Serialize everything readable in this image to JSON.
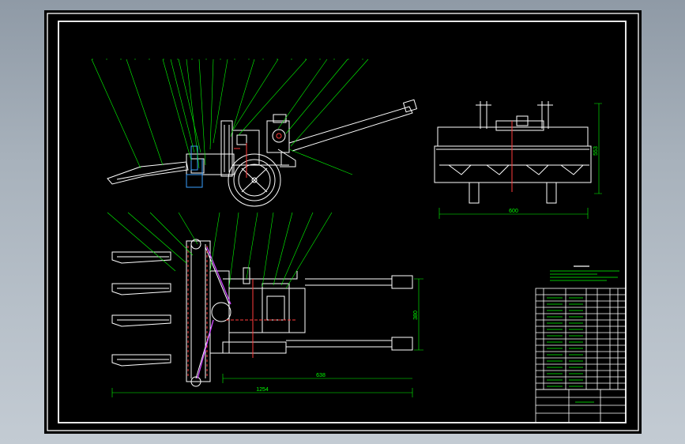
{
  "drawing": {
    "theme_colors": {
      "background": "#000000",
      "outline": "#ffffff",
      "leader": "#00ff00",
      "dimension": "#00ff00",
      "accent": "#ff3b3b",
      "panel": "#8f9aa6"
    },
    "dimensions": {
      "front_width": "600",
      "front_height": "553",
      "plan_total": "1254",
      "plan_inner": "638",
      "plan_handle": "380"
    },
    "title_block": {
      "title": "",
      "notes_heading": ""
    }
  }
}
